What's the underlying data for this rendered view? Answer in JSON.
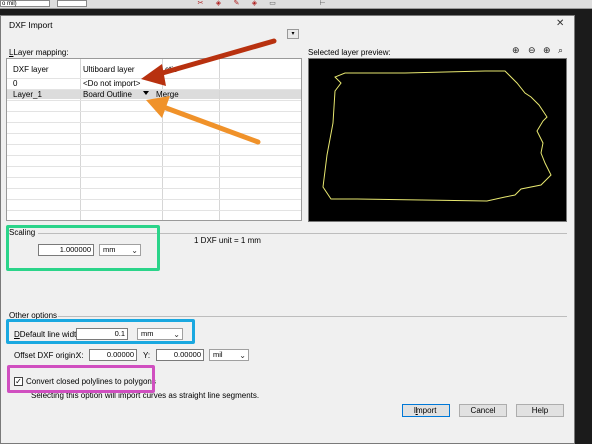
{
  "app_strip": {
    "unit_box": "o mil)",
    "icons": [
      "icon-a",
      "icon-b",
      "icon-c",
      "icon-d",
      "icon-e",
      "icon-f"
    ]
  },
  "dialog": {
    "title": "DXF Import",
    "close_glyph": "✕",
    "layer_mapping_label": "Layer mapping:",
    "layer_mapping_menu_glyph": "▾",
    "preview_label": "Selected layer preview:",
    "zoom_icons": [
      "⊕",
      "⊖",
      "⊕",
      "⌕"
    ],
    "table": {
      "columns": [
        "DXF layer",
        "Ultiboard layer",
        "ctio"
      ],
      "rows": [
        {
          "dxf": "0",
          "ultiboard": "<Do not import>",
          "action": ""
        },
        {
          "dxf": "Layer_1",
          "ultiboard": "Board Outline",
          "action": "Merge"
        }
      ]
    },
    "scaling": {
      "label": "Scaling",
      "value": "1.000000",
      "unit": "mm",
      "info": "1 DXF unit = 1 mm"
    },
    "other_options": {
      "label": "Other options",
      "line_width_label": "Default line width:",
      "line_width_value": "0.1",
      "line_width_unit": "mm",
      "offset_label": "Offset DXF origin:",
      "x_label": "X:",
      "x_value": "0.00000",
      "y_label": "Y:",
      "y_value": "0.00000",
      "offset_unit": "mil",
      "convert_label": "Convert closed polylines to polygons",
      "convert_checked": true,
      "check_glyph": "✓",
      "note": "Selecting this option will import curves as straight line segments."
    },
    "buttons": {
      "import": "Import",
      "cancel": "Cancel",
      "help": "Help"
    }
  },
  "annotation_colors": {
    "red_arrow": "#b8310f",
    "orange_arrow": "#f0922a",
    "green_box": "#2bd48a",
    "cyan_box": "#1aa8e0",
    "magenta_box": "#d04fc0",
    "outline": "#e8e870"
  }
}
